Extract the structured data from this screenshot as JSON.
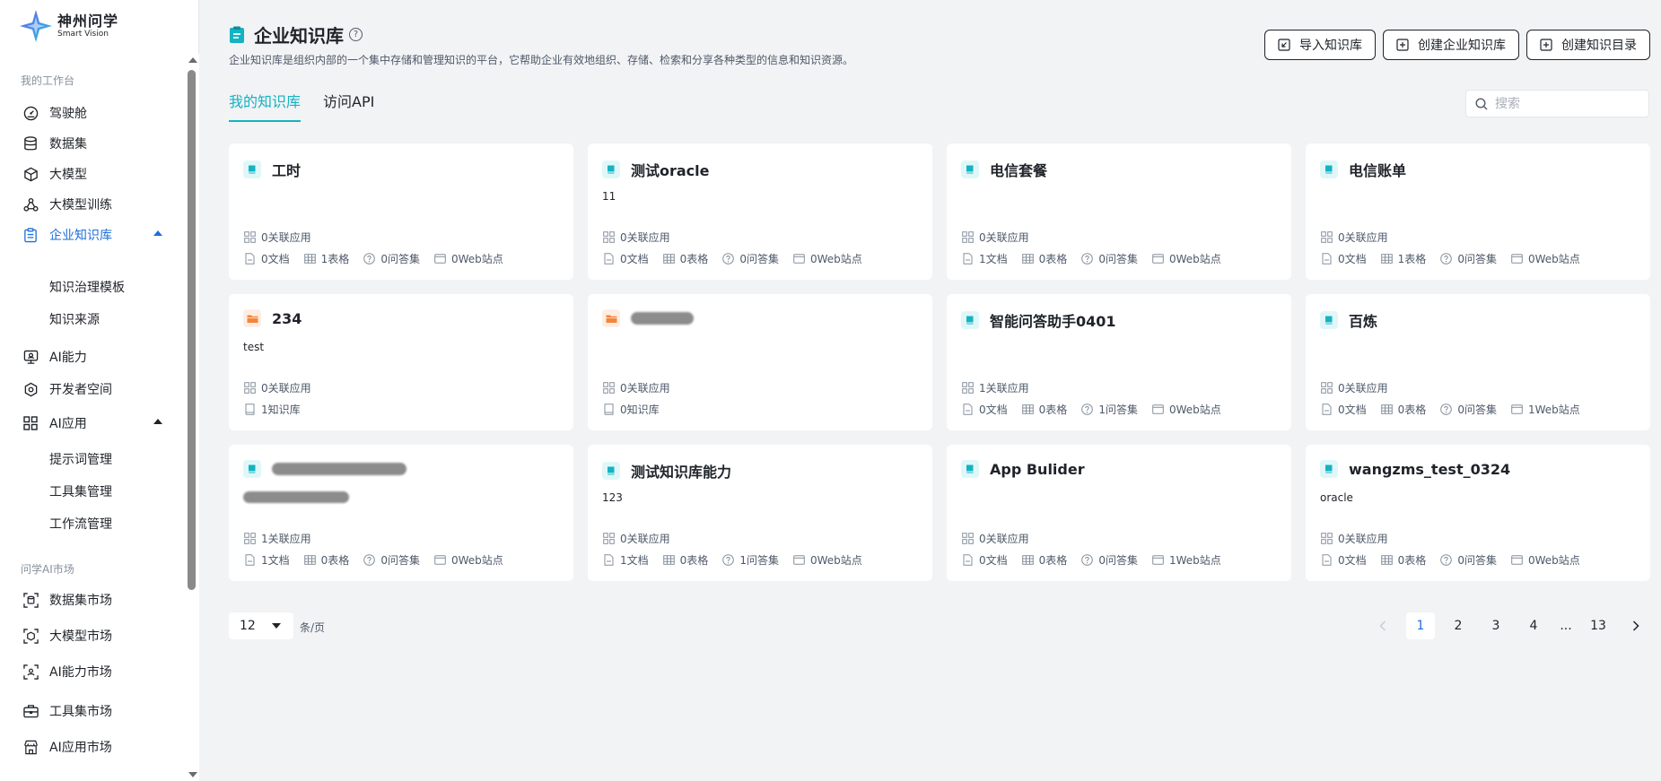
{
  "brand": {
    "name_cn": "神州问学",
    "name_en": "Smart Vision"
  },
  "sidebar": {
    "groups": [
      {
        "title": "我的工作台"
      },
      {
        "title": "问学AI市场"
      }
    ],
    "items": [
      {
        "label": "驾驶舱",
        "icon": "dashboard-icon"
      },
      {
        "label": "数据集",
        "icon": "database-icon"
      },
      {
        "label": "大模型",
        "icon": "cube-icon"
      },
      {
        "label": "大模型训练",
        "icon": "training-icon"
      },
      {
        "label": "企业知识库",
        "icon": "clipboard-icon",
        "active": true
      },
      {
        "label": "AI能力",
        "icon": "monitor-icon"
      },
      {
        "label": "开发者空间",
        "icon": "developer-icon"
      },
      {
        "label": "AI应用",
        "icon": "apps-icon"
      },
      {
        "label": "数据集市场",
        "icon": "dataset-market-icon"
      },
      {
        "label": "大模型市场",
        "icon": "model-market-icon"
      },
      {
        "label": "AI能力市场",
        "icon": "ai-market-icon"
      },
      {
        "label": "工具集市场",
        "icon": "toolbox-icon"
      },
      {
        "label": "AI应用市场",
        "icon": "store-icon"
      }
    ],
    "kb_sub": [
      "知识治理模板",
      "知识来源"
    ],
    "ai_sub": [
      "提示词管理",
      "工具集管理",
      "工作流管理"
    ]
  },
  "header": {
    "title": "企业知识库",
    "help": "?",
    "description": "企业知识库是组织内部的一个集中存储和管理知识的平台，它帮助企业有效地组织、存储、检索和分享各种类型的信息和知识资源。",
    "buttons": {
      "import": "导入知识库",
      "create_kb": "创建企业知识库",
      "create_dir": "创建知识目录"
    }
  },
  "tabs": [
    {
      "label": "我的知识库",
      "active": true
    },
    {
      "label": "访问API"
    }
  ],
  "search": {
    "placeholder": "搜索"
  },
  "labels": {
    "apps_suffix": " 关联应用",
    "docs_suffix": " 文档",
    "tables_suffix": " 表格",
    "qa_suffix": " 问答集",
    "web_suffix": " Web站点",
    "kb_suffix": " 知识库"
  },
  "cards": [
    {
      "name": "工时",
      "desc": "",
      "type": "kb",
      "apps": "0",
      "docs": "0",
      "tables": "1",
      "qa": "0",
      "web": "0"
    },
    {
      "name": "测试oracle",
      "desc": "11",
      "type": "kb",
      "apps": "0",
      "docs": "0",
      "tables": "0",
      "qa": "0",
      "web": "0"
    },
    {
      "name": "电信套餐",
      "desc": "",
      "type": "kb",
      "apps": "0",
      "docs": "1",
      "tables": "0",
      "qa": "0",
      "web": "0"
    },
    {
      "name": "电信账单",
      "desc": "",
      "type": "kb",
      "apps": "0",
      "docs": "0",
      "tables": "1",
      "qa": "0",
      "web": "0"
    },
    {
      "name": "234",
      "desc": "test",
      "type": "folder",
      "apps": "0",
      "kbs": "1"
    },
    {
      "name": "",
      "desc": "",
      "type": "folder",
      "redacted_name": true,
      "apps": "0",
      "kbs": "0"
    },
    {
      "name": "智能问答助手0401",
      "desc": "",
      "type": "kb",
      "apps": "1",
      "docs": "0",
      "tables": "0",
      "qa": "1",
      "web": "0"
    },
    {
      "name": "百炼",
      "desc": "",
      "type": "kb",
      "apps": "0",
      "docs": "0",
      "tables": "0",
      "qa": "0",
      "web": "1"
    },
    {
      "name": "",
      "desc": "",
      "type": "kb",
      "redacted_name": true,
      "redacted_desc": true,
      "apps": "1",
      "docs": "1",
      "tables": "0",
      "qa": "0",
      "web": "0"
    },
    {
      "name": "测试知识库能力",
      "desc": "123",
      "type": "kb",
      "apps": "0",
      "docs": "1",
      "tables": "0",
      "qa": "1",
      "web": "0"
    },
    {
      "name": "App Bulider",
      "desc": "",
      "type": "kb",
      "apps": "0",
      "docs": "0",
      "tables": "0",
      "qa": "0",
      "web": "1"
    },
    {
      "name": "wangzms_test_0324",
      "desc": "oracle",
      "type": "kb",
      "apps": "0",
      "docs": "0",
      "tables": "0",
      "qa": "0",
      "web": "0"
    }
  ],
  "pagination": {
    "page_size": "12",
    "per_page_label": "条/页",
    "pages": [
      "1",
      "2",
      "3",
      "4",
      "...",
      "13"
    ],
    "current": "1"
  },
  "colors": {
    "accent": "#14b3c1",
    "active_blue": "#1d6fd9",
    "folder": "#f5843c"
  }
}
